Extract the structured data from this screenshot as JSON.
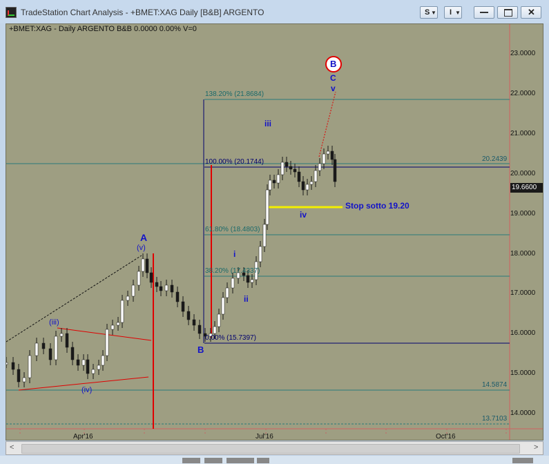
{
  "window": {
    "title": "TradeStation Chart Analysis - +BMET:XAG Daily [B&B] ARGENTO",
    "buttons": {
      "s_label": "S",
      "i_label": "I"
    }
  },
  "chart": {
    "header": "+BMET:XAG - Daily  ARGENTO  B&B  0.0000  0.00%  V=0",
    "y_ticks": [
      "23.0000",
      "22.0000",
      "21.0000",
      "20.0000",
      "19.0000",
      "18.0000",
      "17.0000",
      "16.0000",
      "15.0000",
      "14.0000"
    ],
    "x_ticks": [
      "Apr'16",
      "Jul'16",
      "Oct'16"
    ],
    "price_labels": {
      "last": "19.6600",
      "upper": "20.2439",
      "mid": "14.5874",
      "low": "13.7103"
    },
    "fib_labels": {
      "f1382": "138.20% (21.8684)",
      "f100": "100.00% (20.1744)",
      "f618": "61.80% (18.4803)",
      "f382": "38.20% (17.4337)",
      "f0": "0.00% (15.7397)"
    },
    "wave_labels": {
      "A": "A",
      "v_paren": "(v)",
      "iii_paren": "(iii)",
      "iv_paren": "(iv)",
      "B": "B",
      "i": "i",
      "ii": "ii",
      "iii": "iii",
      "iv": "iv",
      "C": "C",
      "v": "v",
      "B_circle": "B"
    },
    "annotation": "Stop sotto  19.20",
    "colors": {
      "background": "#9e9e82",
      "wave_text": "#1212c8",
      "red_line": "#e00000",
      "fib_line": "#2a7a7a",
      "navy_line": "#00006e",
      "yellow_line": "#f4f000",
      "candles": "#ffffff"
    }
  }
}
